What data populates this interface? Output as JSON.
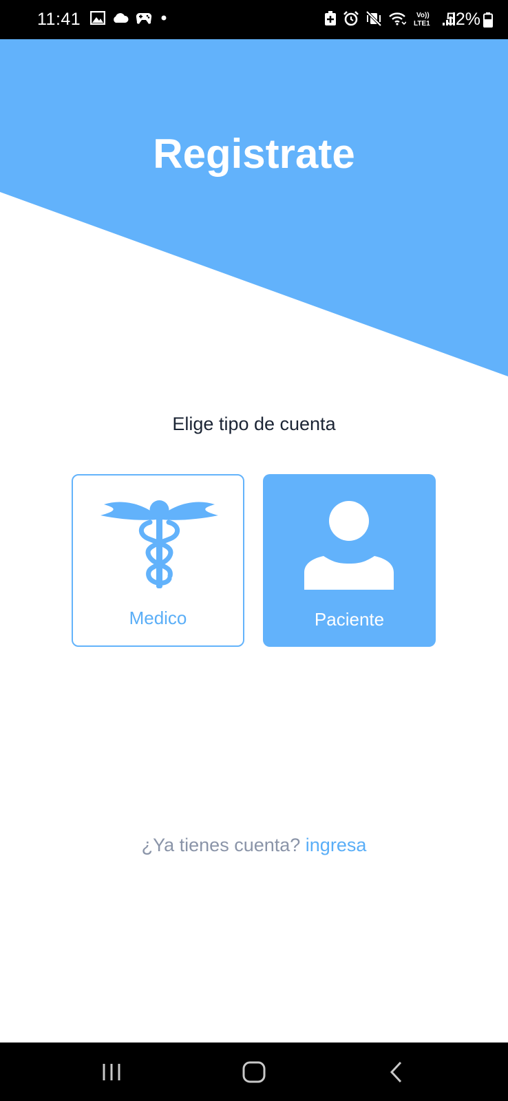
{
  "status_bar": {
    "time": "11:41",
    "battery_percent": "52%",
    "left_icons": [
      "image-icon",
      "cloud-icon",
      "game-controller-icon",
      "dot-icon"
    ],
    "right_icons": [
      "battery-saver-icon",
      "alarm-icon",
      "vibrate-icon",
      "wifi-icon",
      "volte-lte-icon",
      "signal-icon",
      "battery-icon"
    ],
    "volte_text": "Vo)) LTE1"
  },
  "header": {
    "title": "Registrate",
    "background_color": "#62b2fb"
  },
  "subtitle": "Elige tipo de cuenta",
  "account_types": [
    {
      "label": "Medico",
      "icon": "caduceus-icon",
      "selected": false
    },
    {
      "label": "Paciente",
      "icon": "user-icon",
      "selected": true
    }
  ],
  "login": {
    "prompt": "¿Ya tienes cuenta?",
    "link": "ingresa"
  },
  "colors": {
    "accent": "#62b2fb",
    "text_dark": "#1b2434",
    "text_muted": "#8a94a8"
  },
  "nav_bar": {
    "buttons": [
      "recents-icon",
      "home-icon",
      "back-icon"
    ]
  }
}
